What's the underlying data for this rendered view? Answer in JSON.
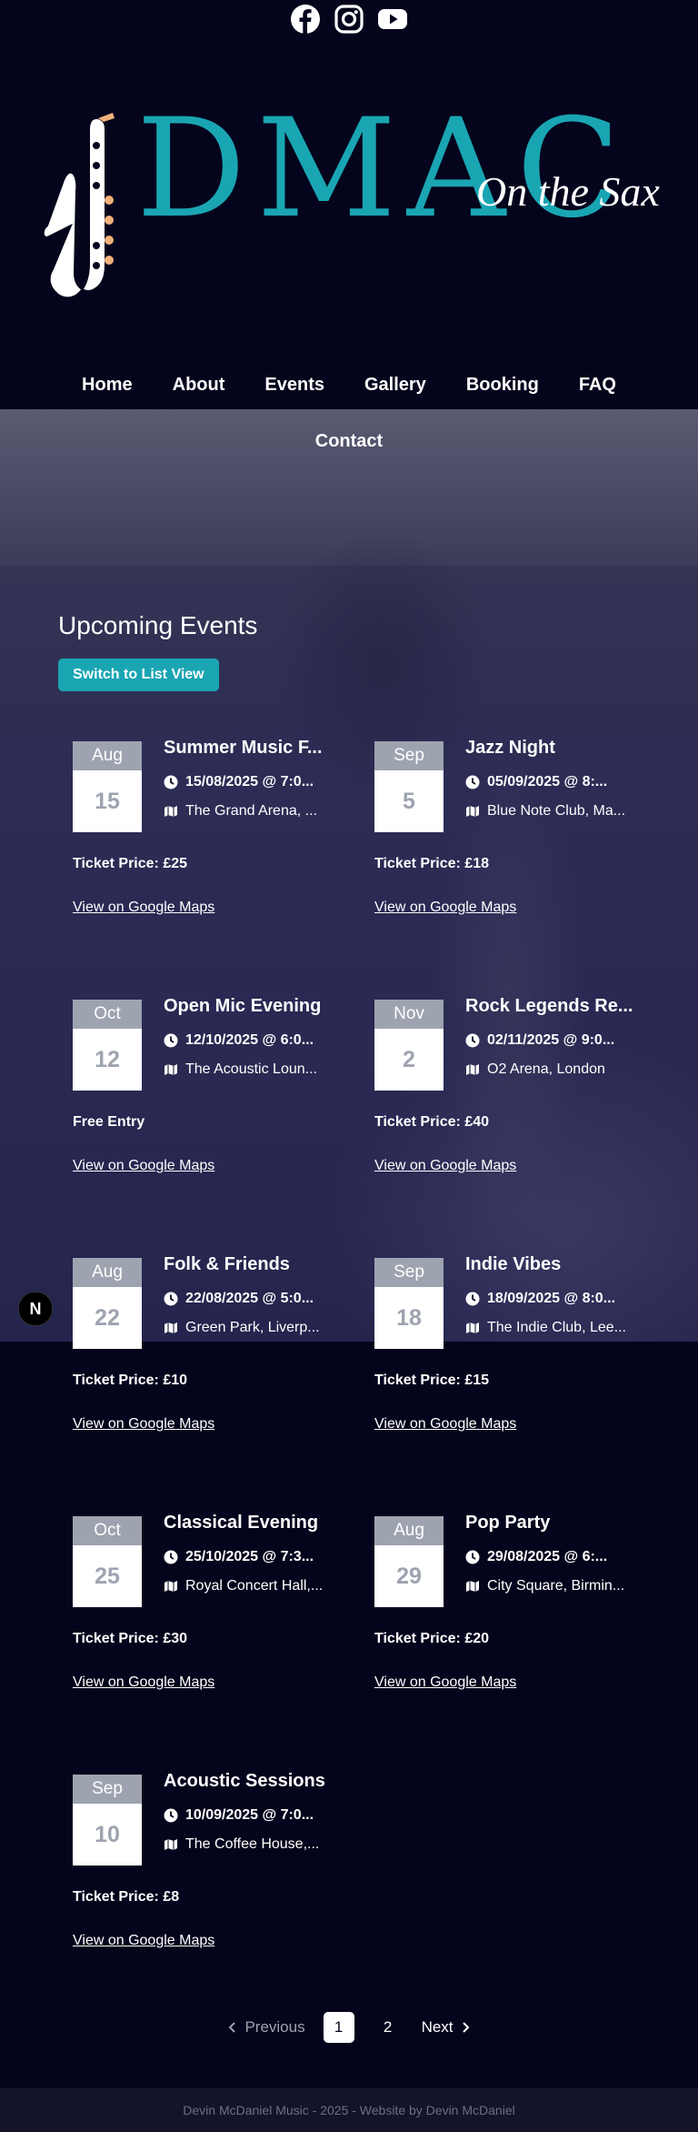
{
  "social": [
    {
      "icon": "facebook-icon"
    },
    {
      "icon": "instagram-icon"
    },
    {
      "icon": "youtube-icon"
    }
  ],
  "logo": {
    "letters": "DMAC",
    "tagline": "On the Sax",
    "accent": "#1aa5b3"
  },
  "nav": {
    "home": "Home",
    "about": "About",
    "events": "Events",
    "gallery": "Gallery",
    "booking": "Booking",
    "faq": "FAQ",
    "contact": "Contact"
  },
  "section": {
    "title": "Upcoming Events",
    "toggle": "Switch to List View"
  },
  "events": [
    {
      "month": "Aug",
      "day": "15",
      "title": "Summer Music F...",
      "when": "15/08/2025 @ 7:0...",
      "where": "The Grand Arena, ...",
      "price": "Ticket Price: £25",
      "map": "View on Google Maps"
    },
    {
      "month": "Sep",
      "day": "5",
      "title": "Jazz Night",
      "when": "05/09/2025 @ 8:...",
      "where": "Blue Note Club, Ma...",
      "price": "Ticket Price: £18",
      "map": "View on Google Maps"
    },
    {
      "month": "Oct",
      "day": "12",
      "title": "Open Mic Evening",
      "when": "12/10/2025 @ 6:0...",
      "where": "The Acoustic Loun...",
      "price": "Free Entry",
      "map": "View on Google Maps"
    },
    {
      "month": "Nov",
      "day": "2",
      "title": "Rock Legends Re...",
      "when": "02/11/2025 @ 9:0...",
      "where": "O2 Arena, London",
      "price": "Ticket Price: £40",
      "map": "View on Google Maps"
    },
    {
      "month": "Aug",
      "day": "22",
      "title": "Folk & Friends",
      "when": "22/08/2025 @ 5:0...",
      "where": "Green Park, Liverp...",
      "price": "Ticket Price: £10",
      "map": "View on Google Maps"
    },
    {
      "month": "Sep",
      "day": "18",
      "title": "Indie Vibes",
      "when": "18/09/2025 @ 8:0...",
      "where": "The Indie Club, Lee...",
      "price": "Ticket Price: £15",
      "map": "View on Google Maps"
    },
    {
      "month": "Oct",
      "day": "25",
      "title": "Classical Evening",
      "when": "25/10/2025 @ 7:3...",
      "where": "Royal Concert Hall,...",
      "price": "Ticket Price: £30",
      "map": "View on Google Maps"
    },
    {
      "month": "Aug",
      "day": "29",
      "title": "Pop Party",
      "when": "29/08/2025 @ 6:...",
      "where": "City Square, Birmin...",
      "price": "Ticket Price: £20",
      "map": "View on Google Maps"
    },
    {
      "month": "Sep",
      "day": "10",
      "title": "Acoustic Sessions",
      "when": "10/09/2025 @ 7:0...",
      "where": "The Coffee House,...",
      "price": "Ticket Price: £8",
      "map": "View on Google Maps"
    }
  ],
  "pagination": {
    "previous": "Previous",
    "pages": [
      "1",
      "2"
    ],
    "current": "1",
    "next": "Next"
  },
  "footer": {
    "text": "Devin McDaniel Music - 2025 - Website by Devin McDaniel"
  },
  "badge": {
    "letter": "N"
  }
}
